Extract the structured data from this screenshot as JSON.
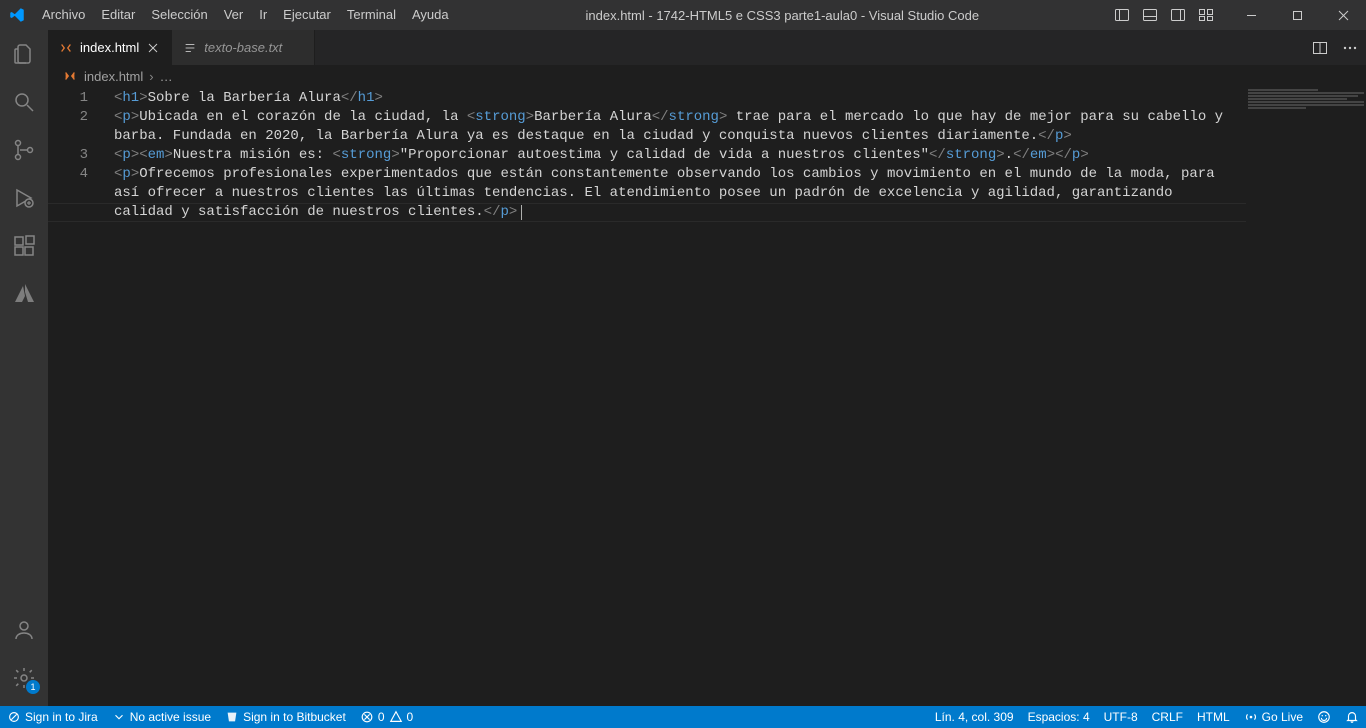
{
  "titlebar": {
    "menus": [
      "Archivo",
      "Editar",
      "Selección",
      "Ver",
      "Ir",
      "Ejecutar",
      "Terminal",
      "Ayuda"
    ],
    "title": "index.html - 1742-HTML5 e CSS3 parte1-aula0 - Visual Studio Code"
  },
  "tabs": [
    {
      "label": "index.html",
      "active": true,
      "icon": "html"
    },
    {
      "label": "texto-base.txt",
      "active": false,
      "italic": true,
      "icon": "text"
    }
  ],
  "breadcrumbs": {
    "file": "index.html",
    "ellipsis": "…"
  },
  "editor": {
    "line_numbers": [
      "1",
      "2",
      "3",
      "4"
    ],
    "lines": [
      [
        {
          "t": "tag",
          "v": "<"
        },
        {
          "t": "name",
          "v": "h1"
        },
        {
          "t": "tag",
          "v": ">"
        },
        {
          "t": "text",
          "v": "Sobre la Barbería Alura"
        },
        {
          "t": "tag",
          "v": "</"
        },
        {
          "t": "name",
          "v": "h1"
        },
        {
          "t": "tag",
          "v": ">"
        }
      ],
      [
        {
          "t": "tag",
          "v": "<"
        },
        {
          "t": "name",
          "v": "p"
        },
        {
          "t": "tag",
          "v": ">"
        },
        {
          "t": "text",
          "v": "Ubicada en el corazón de la ciudad, la "
        },
        {
          "t": "tag",
          "v": "<"
        },
        {
          "t": "name",
          "v": "strong"
        },
        {
          "t": "tag",
          "v": ">"
        },
        {
          "t": "text",
          "v": "Barbería Alura"
        },
        {
          "t": "tag",
          "v": "</"
        },
        {
          "t": "name",
          "v": "strong"
        },
        {
          "t": "tag",
          "v": ">"
        },
        {
          "t": "text",
          "v": " trae para el mercado lo que hay de mejor para su cabello y barba. Fundada en 2020, la Barbería Alura ya es destaque en la ciudad y conquista nuevos clientes diariamente."
        },
        {
          "t": "tag",
          "v": "</"
        },
        {
          "t": "name",
          "v": "p"
        },
        {
          "t": "tag",
          "v": ">"
        }
      ],
      [
        {
          "t": "tag",
          "v": "<"
        },
        {
          "t": "name",
          "v": "p"
        },
        {
          "t": "tag",
          "v": ">"
        },
        {
          "t": "tag",
          "v": "<"
        },
        {
          "t": "name",
          "v": "em"
        },
        {
          "t": "tag",
          "v": ">"
        },
        {
          "t": "text",
          "v": "Nuestra misión es: "
        },
        {
          "t": "tag",
          "v": "<"
        },
        {
          "t": "name",
          "v": "strong"
        },
        {
          "t": "tag",
          "v": ">"
        },
        {
          "t": "text",
          "v": "\"Proporcionar autoestima y calidad de vida a nuestros clientes\""
        },
        {
          "t": "tag",
          "v": "</"
        },
        {
          "t": "name",
          "v": "strong"
        },
        {
          "t": "tag",
          "v": ">"
        },
        {
          "t": "text",
          "v": "."
        },
        {
          "t": "tag",
          "v": "</"
        },
        {
          "t": "name",
          "v": "em"
        },
        {
          "t": "tag",
          "v": ">"
        },
        {
          "t": "tag",
          "v": "</"
        },
        {
          "t": "name",
          "v": "p"
        },
        {
          "t": "tag",
          "v": ">"
        }
      ],
      [
        {
          "t": "tag",
          "v": "<"
        },
        {
          "t": "name",
          "v": "p"
        },
        {
          "t": "tag",
          "v": ">"
        },
        {
          "t": "text",
          "v": "Ofrecemos profesionales experimentados que están constantemente observando los cambios y movimiento en el mundo de la moda, para así ofrecer a nuestros clientes las últimas tendencias. El atendimiento posee un padrón de excelencia y agilidad, garantizando calidad y satisfacción de nuestros clientes."
        },
        {
          "t": "tag",
          "v": "</"
        },
        {
          "t": "name",
          "v": "p"
        },
        {
          "t": "tag",
          "v": ">"
        }
      ]
    ]
  },
  "statusbar": {
    "jira": "Sign in to Jira",
    "issue": "No active issue",
    "bitbucket": "Sign in to Bitbucket",
    "errors": "0",
    "warnings": "0",
    "cursor": "Lín. 4, col. 309",
    "indent": "Espacios: 4",
    "encoding": "UTF-8",
    "eol": "CRLF",
    "lang": "HTML",
    "golive": "Go Live"
  },
  "activitybar": {
    "settings_badge": "1"
  }
}
